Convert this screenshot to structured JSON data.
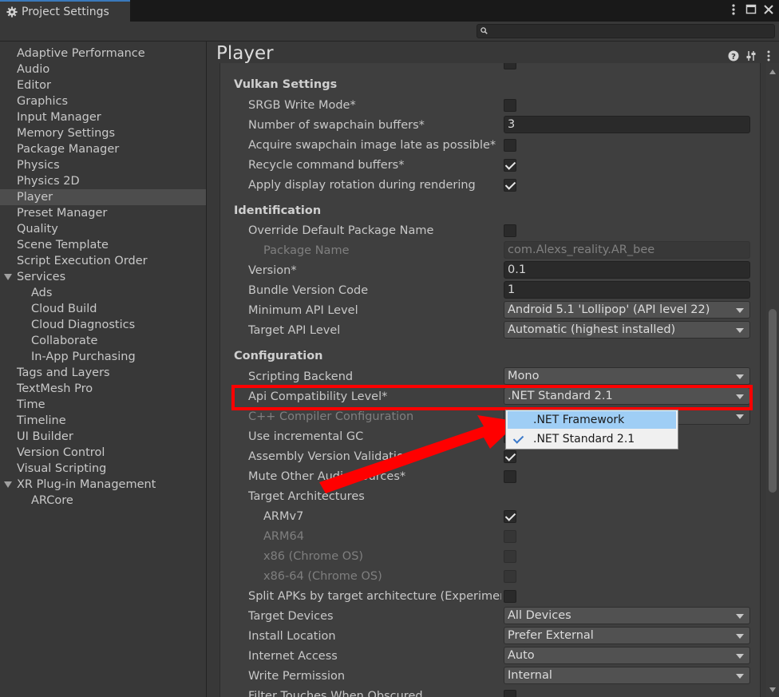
{
  "window": {
    "tab_title": "Project Settings",
    "search_placeholder": ""
  },
  "sidebar": {
    "items": [
      {
        "label": "Adaptive Performance",
        "indent": 0
      },
      {
        "label": "Audio",
        "indent": 0
      },
      {
        "label": "Editor",
        "indent": 0
      },
      {
        "label": "Graphics",
        "indent": 0
      },
      {
        "label": "Input Manager",
        "indent": 0
      },
      {
        "label": "Memory Settings",
        "indent": 0
      },
      {
        "label": "Package Manager",
        "indent": 0
      },
      {
        "label": "Physics",
        "indent": 0
      },
      {
        "label": "Physics 2D",
        "indent": 0
      },
      {
        "label": "Player",
        "indent": 0,
        "selected": true
      },
      {
        "label": "Preset Manager",
        "indent": 0
      },
      {
        "label": "Quality",
        "indent": 0
      },
      {
        "label": "Scene Template",
        "indent": 0
      },
      {
        "label": "Script Execution Order",
        "indent": 0
      },
      {
        "label": "Services",
        "indent": 0,
        "expanded": true
      },
      {
        "label": "Ads",
        "indent": 1
      },
      {
        "label": "Cloud Build",
        "indent": 1
      },
      {
        "label": "Cloud Diagnostics",
        "indent": 1
      },
      {
        "label": "Collaborate",
        "indent": 1
      },
      {
        "label": "In-App Purchasing",
        "indent": 1
      },
      {
        "label": "Tags and Layers",
        "indent": 0
      },
      {
        "label": "TextMesh Pro",
        "indent": 0
      },
      {
        "label": "Time",
        "indent": 0
      },
      {
        "label": "Timeline",
        "indent": 0
      },
      {
        "label": "UI Builder",
        "indent": 0
      },
      {
        "label": "Version Control",
        "indent": 0
      },
      {
        "label": "Visual Scripting",
        "indent": 0
      },
      {
        "label": "XR Plug-in Management",
        "indent": 0,
        "expanded": true
      },
      {
        "label": "ARCore",
        "indent": 1
      }
    ]
  },
  "main": {
    "title": "Player",
    "sections": {
      "vulkan": "Vulkan Settings",
      "identification": "Identification",
      "configuration": "Configuration"
    },
    "rows": [
      {
        "section": "vulkan"
      },
      {
        "label": "SRGB Write Mode*",
        "type": "checkbox",
        "checked": false
      },
      {
        "label": "Number of swapchain buffers*",
        "type": "text",
        "value": "3"
      },
      {
        "label": "Acquire swapchain image late as possible*",
        "type": "checkbox",
        "checked": false
      },
      {
        "label": "Recycle command buffers*",
        "type": "checkbox",
        "checked": true
      },
      {
        "label": "Apply display rotation during rendering",
        "type": "checkbox",
        "checked": true
      },
      {
        "section": "identification"
      },
      {
        "label": "Override Default Package Name",
        "type": "checkbox",
        "checked": false
      },
      {
        "label": "Package Name",
        "type": "text",
        "value": "com.Alexs_reality.AR_bee",
        "dim": true,
        "indent": 1
      },
      {
        "label": "Version*",
        "type": "text",
        "value": "0.1"
      },
      {
        "label": "Bundle Version Code",
        "type": "text",
        "value": "1"
      },
      {
        "label": "Minimum API Level",
        "type": "dropdown",
        "value": "Android 5.1 'Lollipop' (API level 22)"
      },
      {
        "label": "Target API Level",
        "type": "dropdown",
        "value": "Automatic (highest installed)"
      },
      {
        "section": "configuration"
      },
      {
        "label": "Scripting Backend",
        "type": "dropdown",
        "value": "Mono"
      },
      {
        "label": "Api Compatibility Level*",
        "type": "dropdown",
        "value": ".NET Standard 2.1"
      },
      {
        "label": "C++ Compiler Configuration",
        "type": "dropdown",
        "value": "",
        "dim": true
      },
      {
        "label": "Use incremental GC",
        "type": "checkbox",
        "checked": true
      },
      {
        "label": "Assembly Version Validation",
        "type": "checkbox",
        "checked": true
      },
      {
        "label": "Mute Other Audio Sources*",
        "type": "checkbox",
        "checked": false
      },
      {
        "label": "Target Architectures",
        "type": "none"
      },
      {
        "label": "ARMv7",
        "type": "checkbox",
        "checked": true,
        "indent": 1
      },
      {
        "label": "ARM64",
        "type": "checkbox",
        "checked": false,
        "dim": true,
        "indent": 1
      },
      {
        "label": "x86 (Chrome OS)",
        "type": "checkbox",
        "checked": false,
        "dim": true,
        "indent": 1
      },
      {
        "label": "x86-64 (Chrome OS)",
        "type": "checkbox",
        "checked": false,
        "dim": true,
        "indent": 1
      },
      {
        "label": "Split APKs by target architecture (Experimental)",
        "type": "checkbox",
        "checked": false
      },
      {
        "label": "Target Devices",
        "type": "dropdown",
        "value": "All Devices"
      },
      {
        "label": "Install Location",
        "type": "dropdown",
        "value": "Prefer External"
      },
      {
        "label": "Internet Access",
        "type": "dropdown",
        "value": "Auto"
      },
      {
        "label": "Write Permission",
        "type": "dropdown",
        "value": "Internal"
      },
      {
        "label": "Filter Touches When Obscured",
        "type": "checkbox",
        "checked": false
      }
    ]
  },
  "popup": {
    "options": [
      {
        "label": ".NET Framework",
        "hover": true,
        "checked": false
      },
      {
        "label": ".NET Standard 2.1",
        "hover": false,
        "checked": true
      }
    ]
  },
  "annotation": {
    "highlight_color": "#ff0000",
    "arrow_color": "#ff0000"
  },
  "icons": [
    "gear-icon",
    "kebab-menu-icon",
    "maximize-icon",
    "close-icon",
    "search-icon",
    "help-icon",
    "preset-icon",
    "more-icon"
  ]
}
